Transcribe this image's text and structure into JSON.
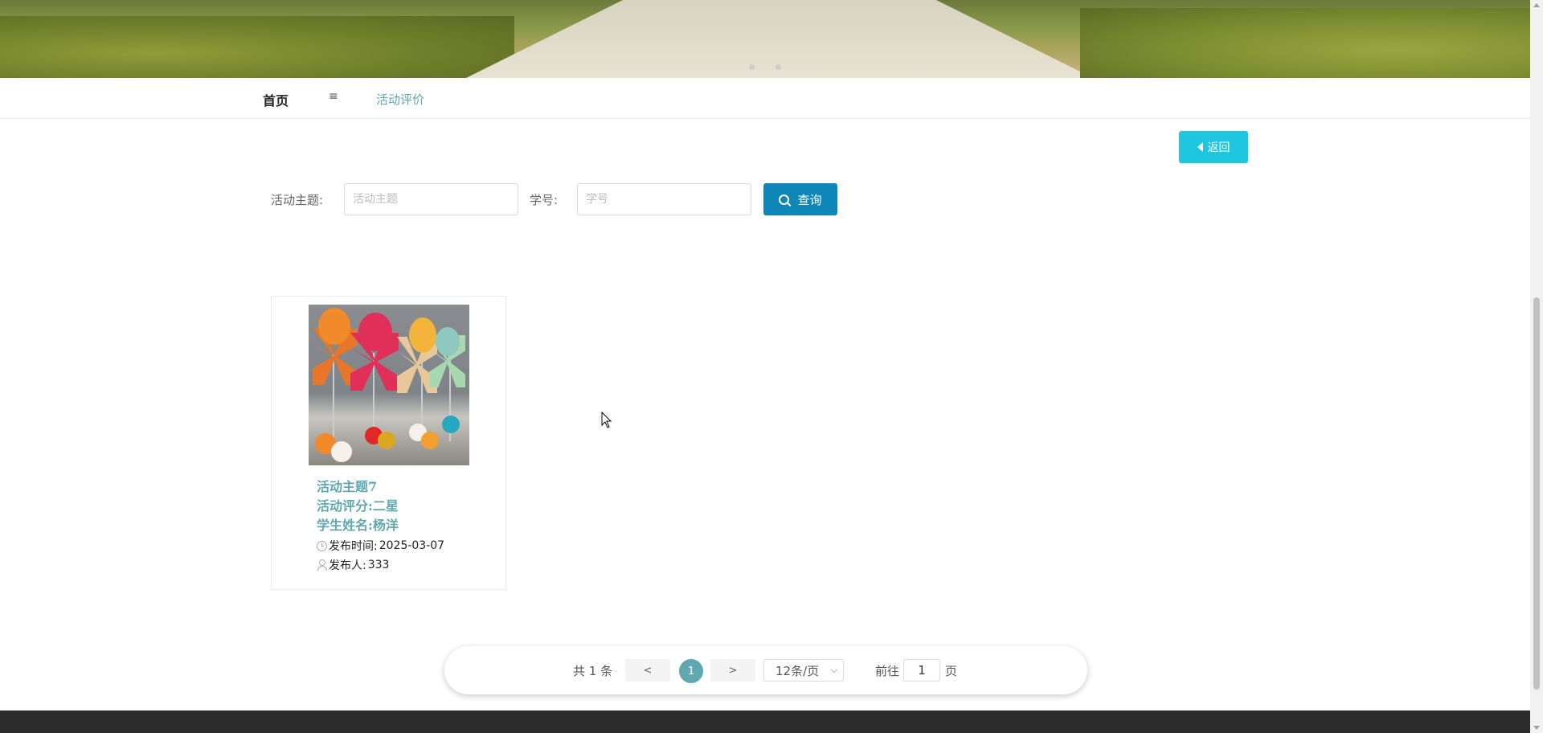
{
  "nav": {
    "home": "首页",
    "separator": "≡",
    "current": "活动评价"
  },
  "actions": {
    "back_label": "返回"
  },
  "search": {
    "topic_label": "活动主题:",
    "topic_placeholder": "活动主题",
    "topic_value": "",
    "student_id_label": "学号:",
    "student_id_placeholder": "学号",
    "student_id_value": "",
    "query_label": "查询"
  },
  "cards": [
    {
      "title": "活动主题7",
      "rating": "活动评分:二星",
      "student": "学生姓名:杨洋",
      "publish_time_label": "发布时间:",
      "publish_time": "2025-03-07",
      "publisher_label": "发布人:",
      "publisher": "333"
    }
  ],
  "pagination": {
    "total": "共 1 条",
    "prev": "<",
    "current_page": "1",
    "next": ">",
    "page_size": "12条/页",
    "goto_label": "前往",
    "goto_value": "1",
    "page_unit": "页"
  },
  "colors": {
    "accent_teal": "#5fa8b0",
    "back_button": "#1ec6e0",
    "query_button": "#0f86b8",
    "footer": "#2b2b2b"
  }
}
